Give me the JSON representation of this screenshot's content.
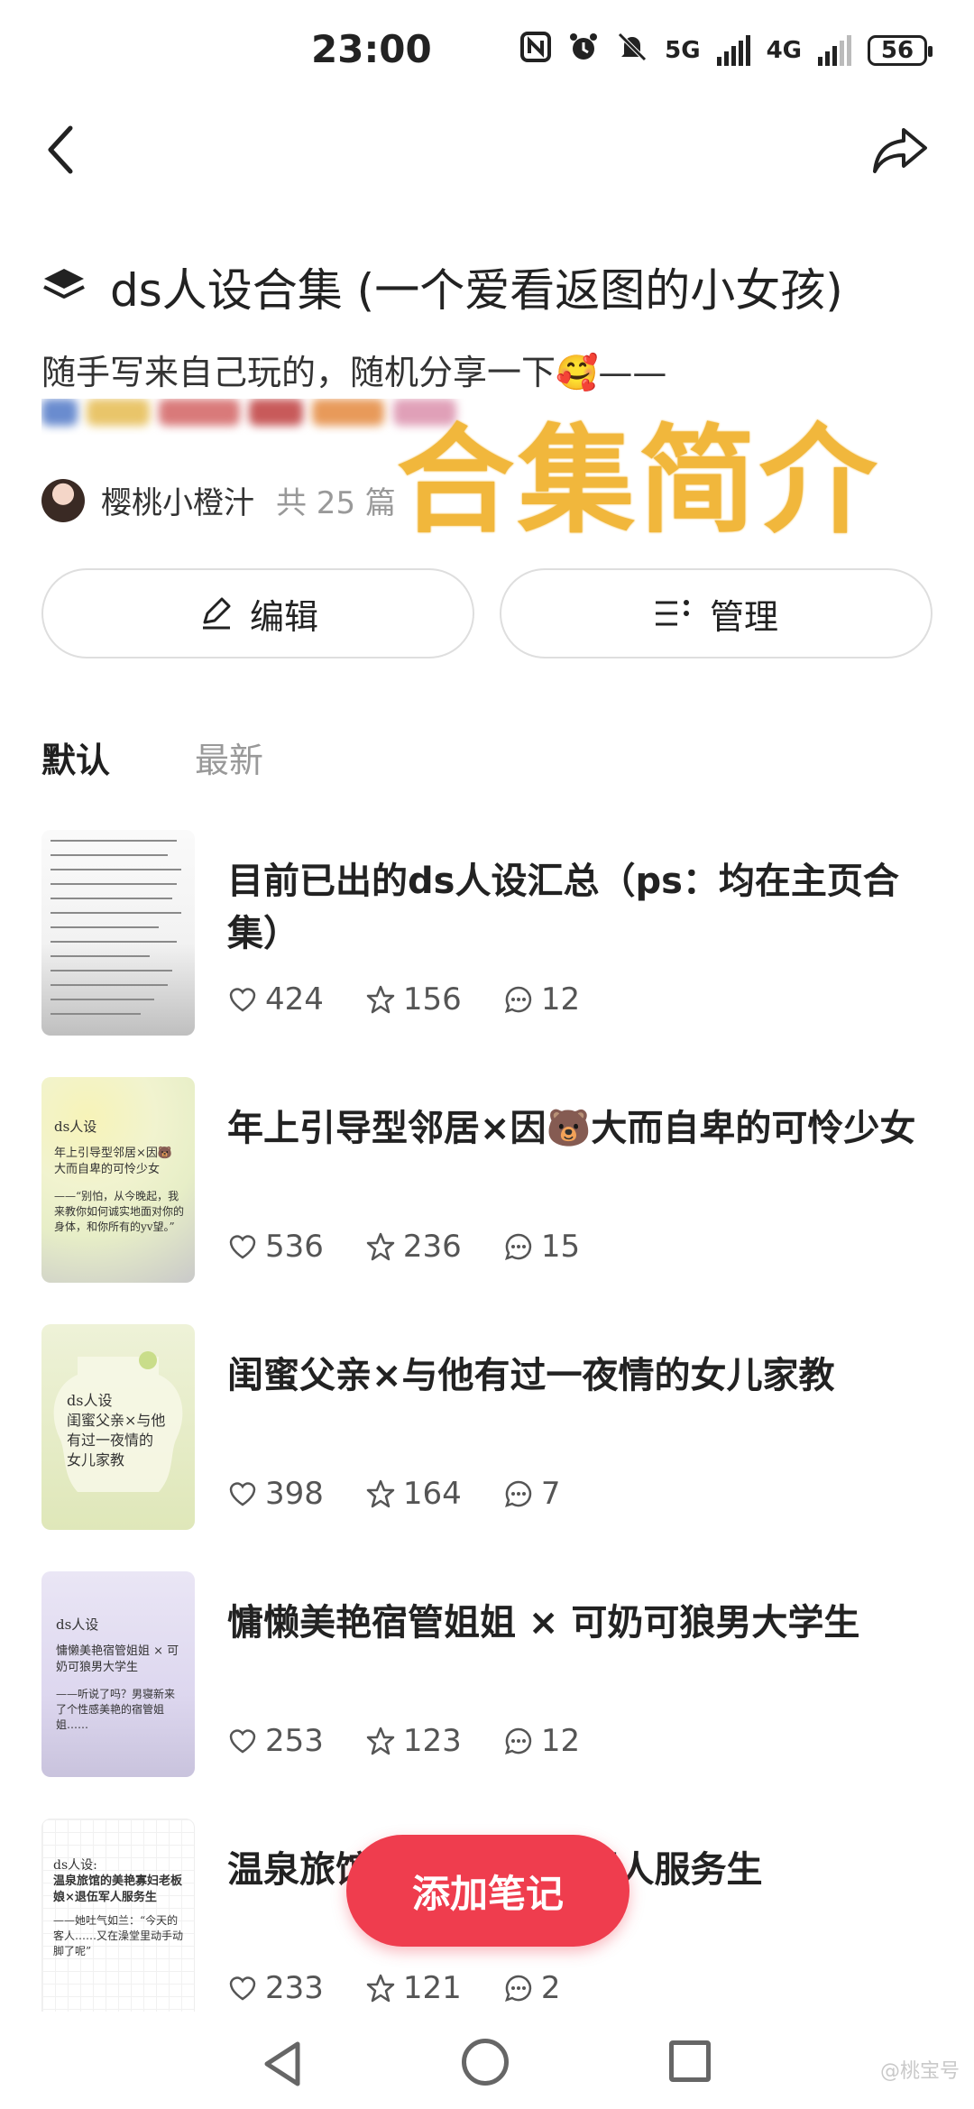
{
  "status_bar": {
    "time": "23:00",
    "net1": "5G",
    "net2": "4G",
    "battery": "56"
  },
  "header": {
    "back_icon": "chevron-left-icon",
    "share_icon": "share-arrow-icon"
  },
  "collection": {
    "title": "ds人设合集 (一个爱看返图的小女孩)",
    "description": "随手写来自己玩的，随机分享一下🥰——",
    "overlay_text": "合集简介",
    "author": "樱桃小橙汁",
    "count": "共 25 篇"
  },
  "actions": {
    "edit_label": "编辑",
    "manage_label": "管理"
  },
  "tabs": [
    {
      "label": "默认",
      "active": true
    },
    {
      "label": "最新",
      "active": false
    }
  ],
  "notes": [
    {
      "title": "目前已出的ds人设汇总（ps：均在主页合集）",
      "likes": "424",
      "stars": "156",
      "comments": "12"
    },
    {
      "title": "年上引导型邻居×因🐻大而自卑的可怜少女",
      "likes": "536",
      "stars": "236",
      "comments": "15",
      "thumb": {
        "tag": "ds人设",
        "heading": "年上引导型邻居×因🐻大而自卑的可怜少女",
        "quote": "——“别怕，从今晚起，我来教你如何诚实地面对你的身体，和你所有的yv望。”"
      }
    },
    {
      "title": "闺蜜父亲×与他有过一夜情的女儿家教",
      "likes": "398",
      "stars": "164",
      "comments": "7",
      "thumb": {
        "text": "ds人设\n闺蜜父亲×与他\n有过一夜情的\n女儿家教"
      }
    },
    {
      "title": "慵懒美艳宿管姐姐 × 可奶可狼男大学生",
      "likes": "253",
      "stars": "123",
      "comments": "12",
      "thumb": {
        "tag": "ds人设",
        "heading": "慵懒美艳宿管姐姐 × 可奶可狼男大学生",
        "quote": "——听说了吗？男寝新来了个性感美艳的宿管姐姐……"
      }
    },
    {
      "title": "温泉旅馆老板娘×退伍军人服务生",
      "likes": "233",
      "stars": "121",
      "comments": "2",
      "thumb": {
        "tag": "ds人设:",
        "heading": "温泉旅馆的美艳寡妇老板娘×退伍军人服务生",
        "quote": "——她吐气如兰：“今天的客人……又在澡堂里动手动脚了呢”"
      }
    }
  ],
  "fab": {
    "label": "添加笔记"
  },
  "colors": {
    "accent": "#ef3d4e",
    "overlay": "#f1b73c"
  },
  "watermark": "@桃宝号"
}
